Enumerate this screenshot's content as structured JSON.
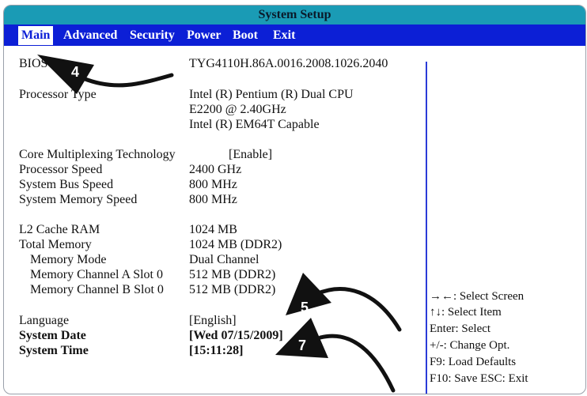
{
  "title": "System Setup",
  "menu": [
    "Main",
    "Advanced",
    "Security",
    "Power",
    "Boot",
    "Exit"
  ],
  "info": {
    "bios_label": "BIOS",
    "bios_value": "TYG4110H.86A.0016.2008.1026.2040",
    "processor_type_label": "Processor Type",
    "processor_type_line1": "Intel (R) Pentium (R) Dual CPU",
    "processor_type_line2": "E2200 @ 2.40GHz",
    "processor_type_line3": "Intel  (R)  EM64T  Capable",
    "core_mux_label": "Core Multiplexing Technology",
    "core_mux_value": "[Enable]",
    "processor_speed_label": "Processor Speed",
    "processor_speed_value": "2400 GHz",
    "system_bus_label": "System Bus Speed",
    "system_bus_value": "800 MHz",
    "system_memory_speed_label": "System Memory Speed",
    "system_memory_speed_value": "800 MHz",
    "l2_cache_label": "L2 Cache RAM",
    "l2_cache_value": "1024 MB",
    "total_memory_label": "Total Memory",
    "total_memory_value": "1024 MB (DDR2)",
    "memory_mode_label": "Memory Mode",
    "memory_mode_value": "Dual Channel",
    "channel_a_label": "Memory Channel A Slot 0",
    "channel_a_value": "512 MB (DDR2)",
    "channel_b_label": "Memory Channel B Slot 0",
    "channel_b_value": "512 MB (DDR2)",
    "language_label": "Language",
    "language_value": "[English]",
    "system_date_label": "System Date",
    "system_date_value": "[Wed 07/15/2009]",
    "system_time_label": "System Time",
    "system_time_value": "[15:11:28]"
  },
  "help": [
    "→←:  Select Screen",
    "↑↓:  Select Item",
    "Enter:  Select",
    "+/-:  Change Opt.",
    "F9:  Load Defaults",
    "F10:  Save  ESC: Exit"
  ],
  "markers": [
    "4",
    "5",
    "7"
  ],
  "colors": {
    "titlebar": "#1a9bb5",
    "menubar": "#0c1fd6",
    "divider": "#2a3bd8",
    "arrow": "#111111"
  }
}
